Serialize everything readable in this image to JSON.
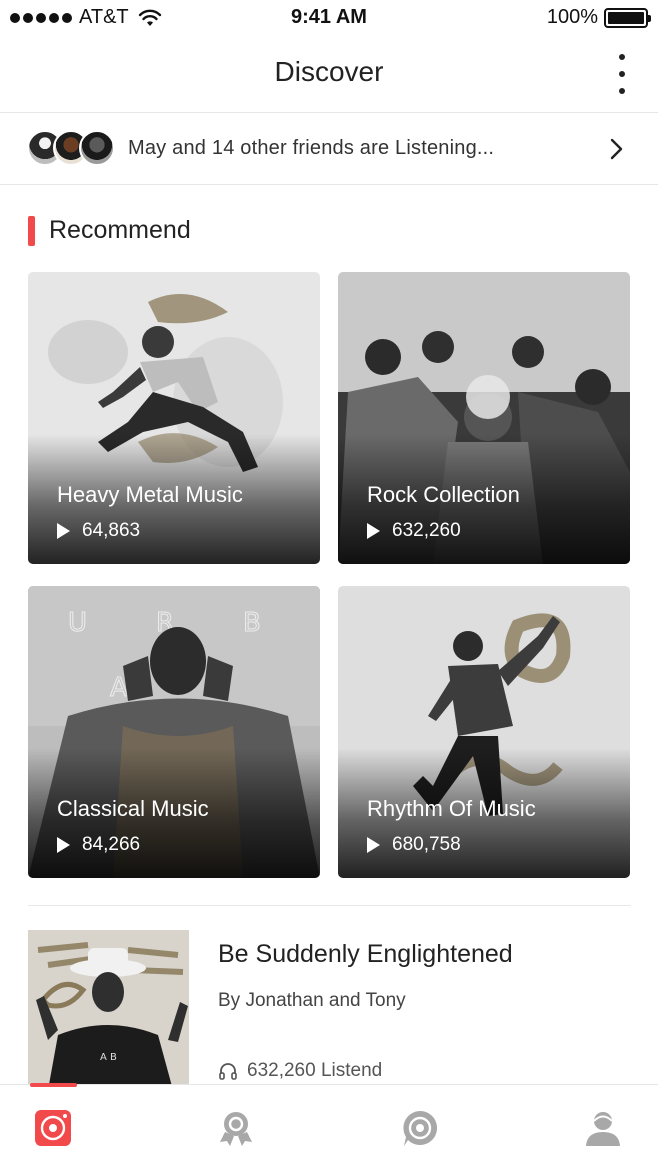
{
  "status_bar": {
    "carrier": "AT&T",
    "time": "9:41 AM",
    "battery": "100%"
  },
  "nav": {
    "title": "Discover"
  },
  "friends_bar": {
    "text": "May and 14 other friends are Listening..."
  },
  "recommend": {
    "title": "Recommend",
    "cards": [
      {
        "title": "Heavy Metal Music",
        "plays": "64,863"
      },
      {
        "title": "Rock  Collection",
        "plays": "632,260"
      },
      {
        "title": "Classical Music",
        "plays": "84,266"
      },
      {
        "title": "Rhythm Of Music",
        "plays": "680,758"
      }
    ]
  },
  "album": {
    "title": "Be Suddenly Englightened",
    "artist": "By Jonathan and Tony",
    "listens": "632,260 Listend"
  },
  "colors": {
    "accent": "#f24a4a",
    "tab_inactive": "#9b9b9b"
  },
  "tabs": [
    {
      "icon": "record-player-icon",
      "active": true
    },
    {
      "icon": "award-icon",
      "active": false
    },
    {
      "icon": "target-icon",
      "active": false
    },
    {
      "icon": "user-icon",
      "active": false
    }
  ]
}
